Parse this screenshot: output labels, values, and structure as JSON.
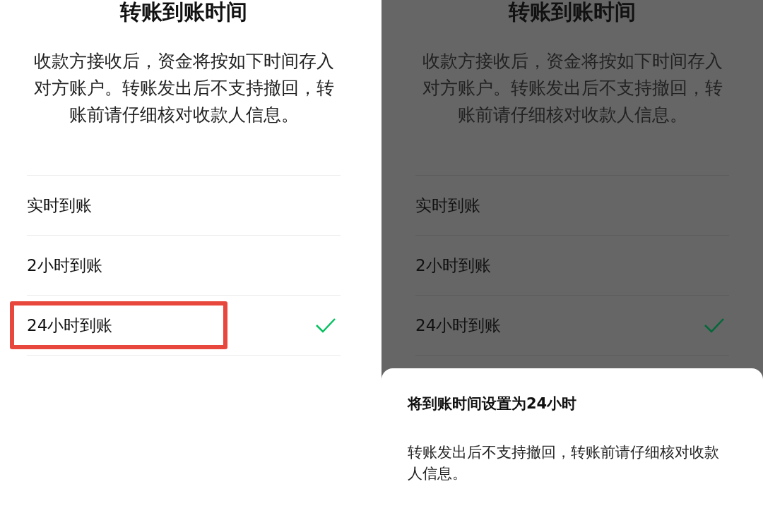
{
  "panels": [
    {
      "title": "转账到账时间",
      "description": "收款方接收后，资金将按如下时间存入对方账户。转账发出后不支持撤回，转账前请仔细核对收款人信息。",
      "dimmed": false,
      "options": [
        {
          "label": "实时到账",
          "selected": false,
          "highlighted": false
        },
        {
          "label": "2小时到账",
          "selected": false,
          "highlighted": false
        },
        {
          "label": "24小时到账",
          "selected": true,
          "highlighted": true
        }
      ]
    },
    {
      "title": "转账到账时间",
      "description": "收款方接收后，资金将按如下时间存入对方账户。转账发出后不支持撤回，转账前请仔细核对收款人信息。",
      "dimmed": true,
      "options": [
        {
          "label": "实时到账",
          "selected": false,
          "highlighted": false
        },
        {
          "label": "2小时到账",
          "selected": false,
          "highlighted": false
        },
        {
          "label": "24小时到账",
          "selected": true,
          "highlighted": false
        }
      ],
      "sheet": {
        "title": "将到账时间设置为24小时",
        "message": "转账发出后不支持撤回，转账前请仔细核对收款人信息。"
      }
    }
  ]
}
